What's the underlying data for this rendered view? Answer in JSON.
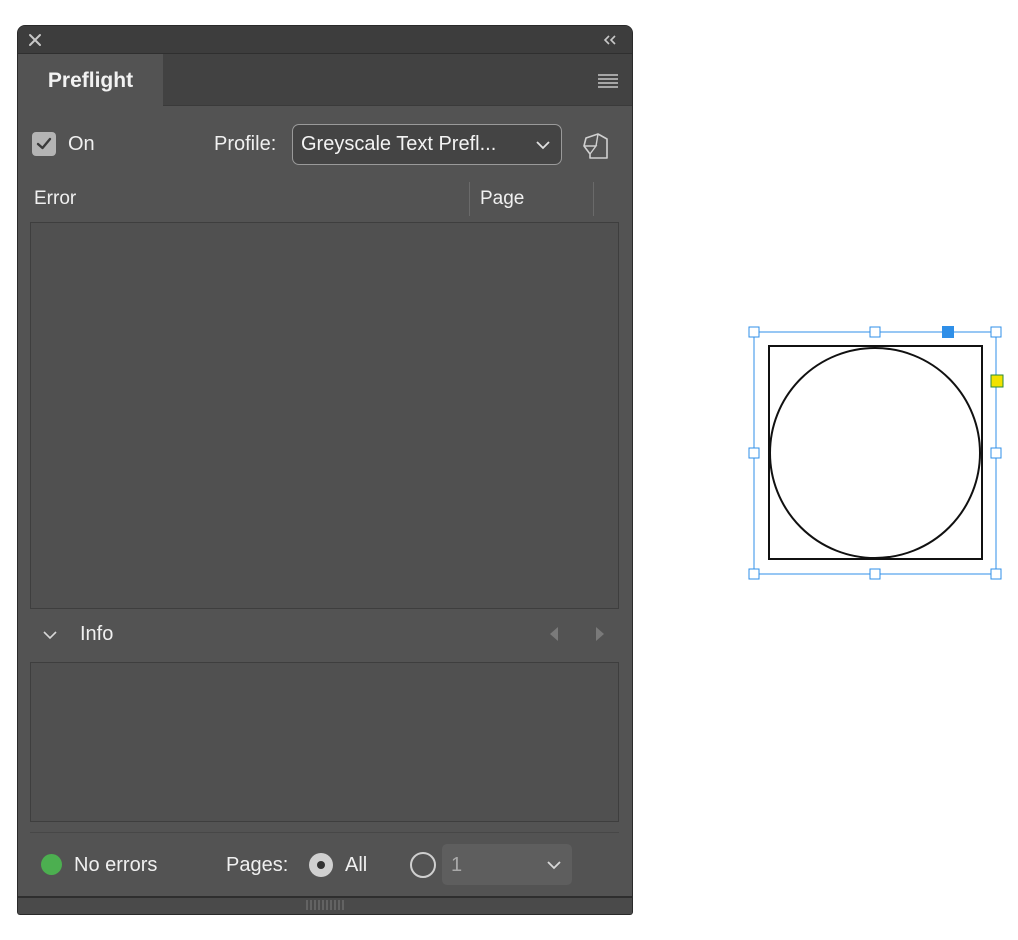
{
  "panel": {
    "tab_label": "Preflight",
    "on_label": "On",
    "on_checked": true,
    "profile_label": "Profile:",
    "profile_value": "Greyscale Text Prefl...",
    "columns": [
      "Error",
      "Page"
    ],
    "info_label": "Info",
    "status": {
      "text": "No errors",
      "color": "#4caf50"
    },
    "pages_label": "Pages:",
    "pages_all_label": "All",
    "pages_all_selected": true,
    "page_range_value": "1"
  },
  "icons": {
    "close": "close-icon",
    "collapse": "collapse-panel-icon",
    "menu": "panel-menu-icon",
    "profile_define": "define-profiles-icon",
    "info_toggle": "chevron-down-icon",
    "prev": "arrow-left-icon",
    "next": "arrow-right-icon",
    "grip": "resize-grip-icon"
  },
  "colors": {
    "panel_bg": "#535353",
    "selection_blue": "#2f8fe8",
    "anchor_yellow": "#f2e200"
  }
}
